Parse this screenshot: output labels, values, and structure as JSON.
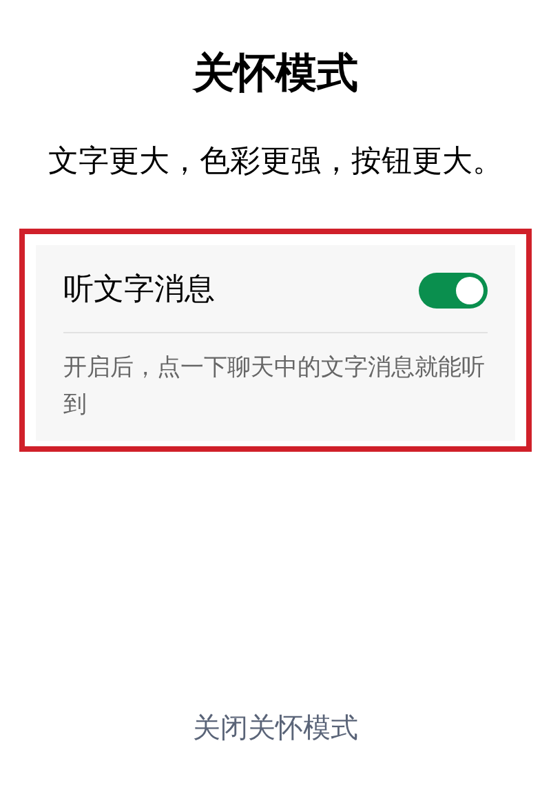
{
  "title": "关怀模式",
  "subtitle": "文字更大，色彩更强，按钮更大。",
  "setting": {
    "label": "听文字消息",
    "on": true,
    "description": "开启后，点一下聊天中的文字消息就能听到"
  },
  "footer_link": "关闭关怀模式"
}
